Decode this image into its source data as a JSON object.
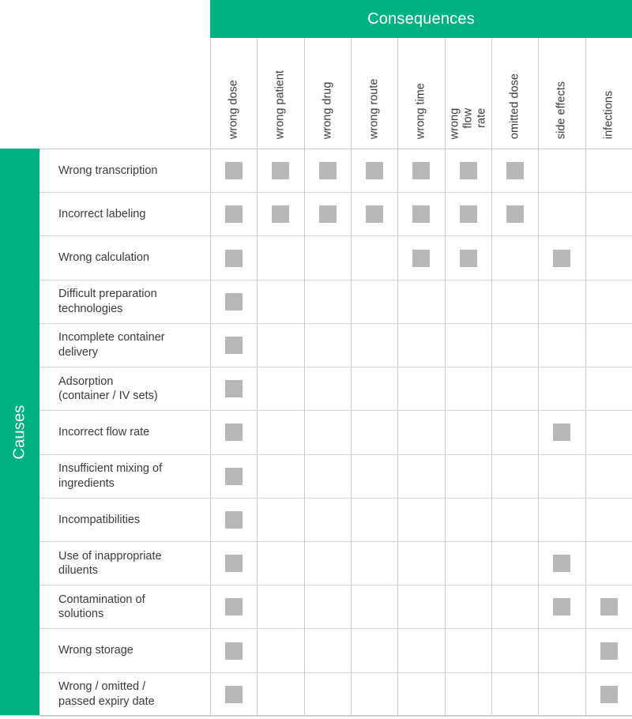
{
  "colors": {
    "accent_green": "#00b283",
    "marker_gray": "#b8b8b8",
    "grid_line": "#c9c9c9",
    "text": "#3a3a3a"
  },
  "header": {
    "consequences_label": "Consequences",
    "causes_label": "Causes"
  },
  "chart_data": {
    "type": "table",
    "title": "Consequences",
    "xlabel": "Consequences",
    "ylabel": "Causes",
    "categories": [
      "wrong dose",
      "wrong patient",
      "wrong drug",
      "wrong route",
      "wrong time",
      "wrong flow\nrate",
      "omitted dose",
      "side effects",
      "infections"
    ],
    "rows": [
      "Wrong transcription",
      "Incorrect labeling",
      "Wrong calculation",
      "Difficult preparation\ntechnologies",
      "Incomplete container\ndelivery",
      "Adsorption\n(container / IV sets)",
      "Incorrect flow rate",
      "Insufficient mixing of\ningredients",
      "Incompatibilities",
      "Use of inappropriate\ndiluents",
      "Contamination of\nsolutions",
      "Wrong storage",
      "Wrong / omitted /\npassed expiry date"
    ],
    "matrix": [
      [
        1,
        1,
        1,
        1,
        1,
        1,
        1,
        0,
        0
      ],
      [
        1,
        1,
        1,
        1,
        1,
        1,
        1,
        0,
        0
      ],
      [
        1,
        0,
        0,
        0,
        1,
        1,
        0,
        1,
        0
      ],
      [
        1,
        0,
        0,
        0,
        0,
        0,
        0,
        0,
        0
      ],
      [
        1,
        0,
        0,
        0,
        0,
        0,
        0,
        0,
        0
      ],
      [
        1,
        0,
        0,
        0,
        0,
        0,
        0,
        0,
        0
      ],
      [
        1,
        0,
        0,
        0,
        0,
        0,
        0,
        1,
        0
      ],
      [
        1,
        0,
        0,
        0,
        0,
        0,
        0,
        0,
        0
      ],
      [
        1,
        0,
        0,
        0,
        0,
        0,
        0,
        0,
        0
      ],
      [
        1,
        0,
        0,
        0,
        0,
        0,
        0,
        1,
        0
      ],
      [
        1,
        0,
        0,
        0,
        0,
        0,
        0,
        1,
        1
      ],
      [
        1,
        0,
        0,
        0,
        0,
        0,
        0,
        0,
        1
      ],
      [
        1,
        0,
        0,
        0,
        0,
        0,
        0,
        0,
        1
      ]
    ],
    "legend": [],
    "grid": true
  }
}
